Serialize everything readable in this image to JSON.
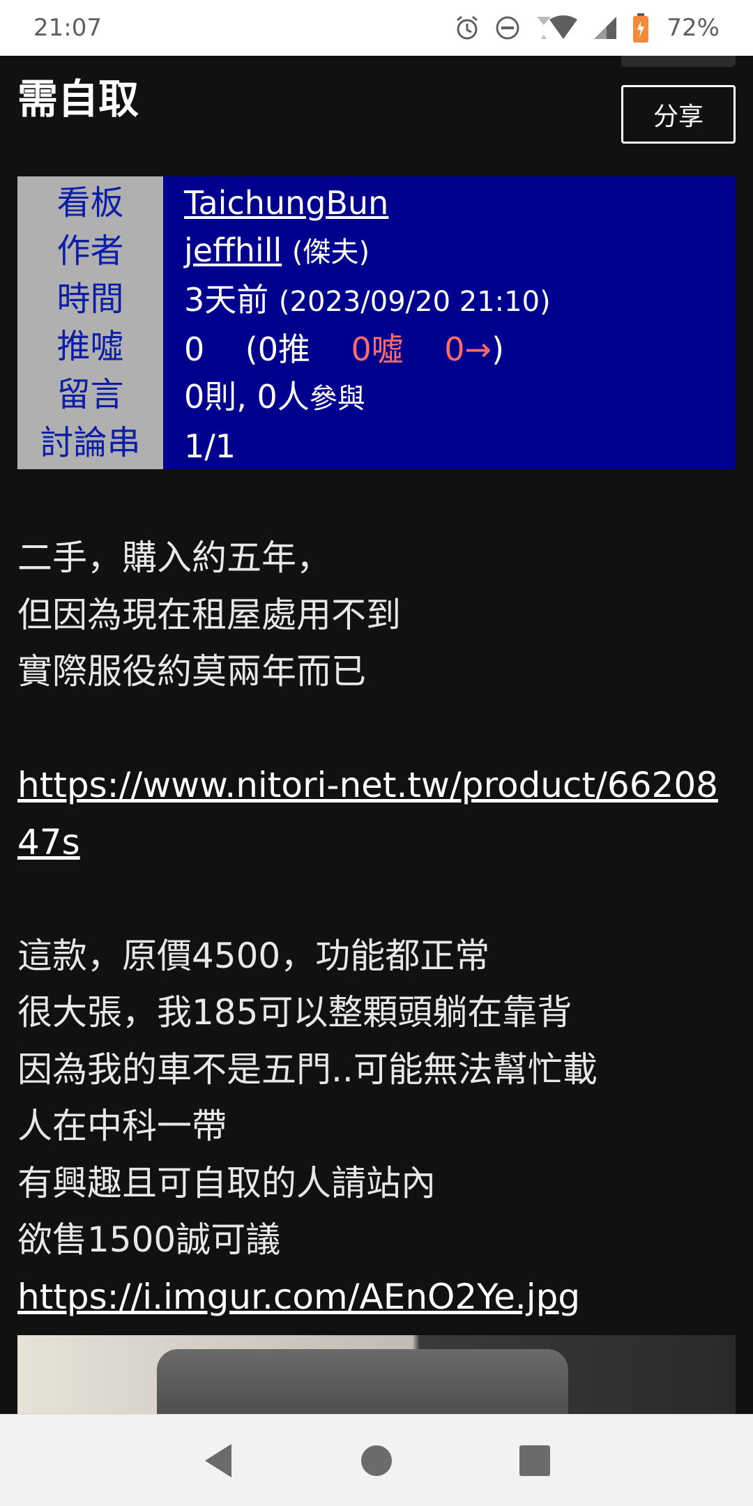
{
  "status_bar": {
    "time": "21:07",
    "battery_percent": "72%",
    "icons": [
      "alarm-icon",
      "do-not-disturb-icon",
      "wifi-icon",
      "signal-icon",
      "battery-icon"
    ]
  },
  "article": {
    "title": "需自取",
    "share_label": "分享"
  },
  "meta": {
    "labels": [
      "看板",
      "作者",
      "時間",
      "推噓",
      "留言",
      "討論串"
    ],
    "board": "TaichungBun",
    "author_id": "jeffhill",
    "author_nick": "(傑夫)",
    "time_relative": "3天前",
    "time_exact": "(2023/09/20 21:10)",
    "score": "0",
    "push_open": "(0推",
    "boo": "0噓",
    "arrow": "0→",
    "push_close": ")",
    "comments": "0則, 0人",
    "comments_suffix": "參與",
    "thread": "1/1"
  },
  "body": {
    "line1": "二手，購入約五年，",
    "line2": "但因為現在租屋處用不到",
    "line3": "實際服役約莫兩年而已",
    "link1": "https://www.nitori-net.tw/product/6620847s",
    "line4": "這款，原價4500，功能都正常",
    "line5": "很大張，我185可以整顆頭躺在靠背",
    "line6": "因為我的車不是五門..可能無法幫忙載",
    "line7": "人在中科一帶",
    "line8": "有興趣且可自取的人請站內",
    "line9": "欲售1500誠可議",
    "link2": "https://i.imgur.com/AEnO2Ye.jpg"
  },
  "colors": {
    "background": "#111111",
    "meta_label_bg": "#b0b0b0",
    "meta_label_text": "#0d1ea6",
    "meta_value_bg": "#00008f",
    "boo_red": "#ff6b6b"
  }
}
